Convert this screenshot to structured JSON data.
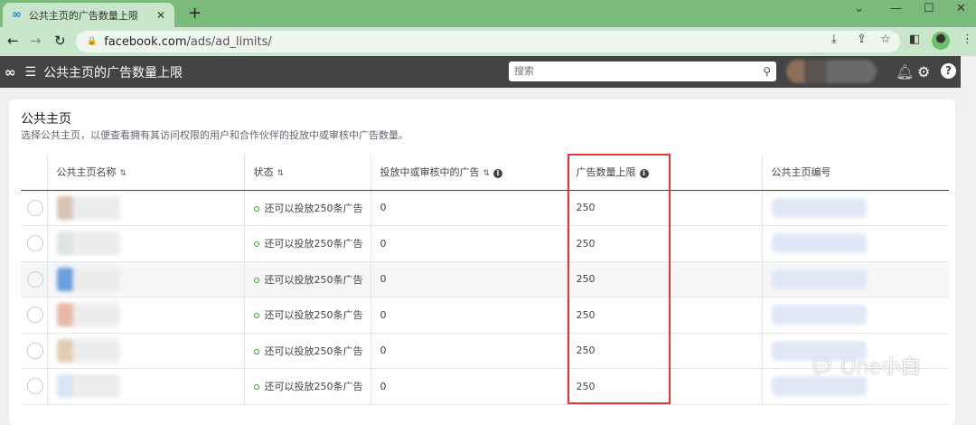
{
  "browser": {
    "tab_title": "公共主页的广告数量上限",
    "url_host": "facebook.com",
    "url_path": "/ads/ad_limits/"
  },
  "header": {
    "title": "公共主页的广告数量上限",
    "search_placeholder": "搜索"
  },
  "card": {
    "title": "公共主页",
    "subtitle": "选择公共主页，以便查看拥有其访问权限的用户和合作伙伴的投放中或审核中广告数量。"
  },
  "table": {
    "columns": [
      "公共主页名称",
      "状态",
      "投放中或审核中的广告",
      "广告数量上限",
      "公共主页编号"
    ],
    "rows": [
      {
        "status": "还可以投放250条广告",
        "active": "0",
        "limit": "250",
        "swatch": "#d8c2b2"
      },
      {
        "status": "还可以投放250条广告",
        "active": "0",
        "limit": "250",
        "swatch": "#dde5e0"
      },
      {
        "status": "还可以投放250条广告",
        "active": "0",
        "limit": "250",
        "swatch": "#6a9fe0"
      },
      {
        "status": "还可以投放250条广告",
        "active": "0",
        "limit": "250",
        "swatch": "#e8b8a4"
      },
      {
        "status": "还可以投放250条广告",
        "active": "0",
        "limit": "250",
        "swatch": "#e2cdb0"
      },
      {
        "status": "还可以投放250条广告",
        "active": "0",
        "limit": "250",
        "swatch": "#d6e6f5"
      }
    ]
  },
  "status_color": "#2aa32a",
  "highlight_color": "#e53935",
  "watermark": "One小白"
}
